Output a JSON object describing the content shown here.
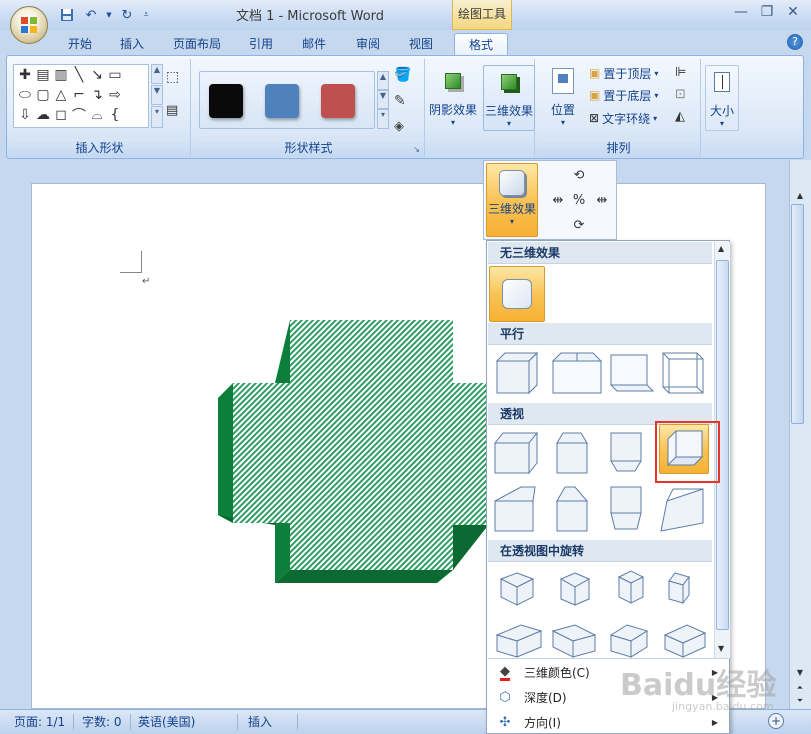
{
  "window": {
    "doc_title": "文档 1 - Microsoft Word",
    "context_tab_group": "绘图工具"
  },
  "tabs": [
    {
      "label": "开始"
    },
    {
      "label": "插入"
    },
    {
      "label": "页面布局"
    },
    {
      "label": "引用"
    },
    {
      "label": "邮件"
    },
    {
      "label": "审阅"
    },
    {
      "label": "视图"
    },
    {
      "label": "格式",
      "active": true
    }
  ],
  "ribbon": {
    "insert_shapes_group": "插入形状",
    "shape_styles_group": "形状样式",
    "style_swatches": [
      "#0a0a0a",
      "#4f81bd",
      "#c0504d"
    ],
    "shadow_effects": "阴影效果",
    "threed_effects": "三维效果",
    "arrange_group": "排列",
    "position": "位置",
    "bring_to_front": "置于顶层",
    "send_to_back": "置于底层",
    "text_wrapping": "文字环绕",
    "size": "大小"
  },
  "flyout": {
    "threed_effects_button": "三维效果",
    "no_3d": "无三维效果",
    "parallel": "平行",
    "perspective": "透视",
    "rotate_in_perspective": "在透视图中旋转",
    "menu": [
      {
        "label": "三维颜色(C)",
        "icon": "fill-color-icon"
      },
      {
        "label": "深度(D)",
        "icon": "depth-icon"
      },
      {
        "label": "方向(I)",
        "icon": "direction-icon"
      }
    ]
  },
  "shape": {
    "face_color": "#2f9d63",
    "side_color": "#0c7f3c",
    "dark_side_color": "#0a6a31"
  },
  "statusbar": {
    "page": "页面: 1/1",
    "words": "字数: 0",
    "language": "英语(美国)",
    "mode": "插入"
  },
  "watermark": {
    "brand": "Baidu经验",
    "url": "jingyan.baidu.com"
  }
}
